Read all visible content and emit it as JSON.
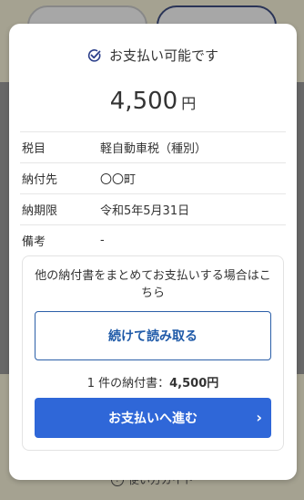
{
  "background": {
    "guide_label": "使い方ガイド"
  },
  "modal": {
    "status_text": "お支払い可能です",
    "amount": "4,500",
    "amount_unit": "円",
    "rows": [
      {
        "label": "税目",
        "value": "軽自動車税（種別）"
      },
      {
        "label": "納付先",
        "value": "〇〇町"
      },
      {
        "label": "納期限",
        "value": "令和5年5月31日"
      },
      {
        "label": "備考",
        "value": "-"
      }
    ],
    "panel": {
      "note": "他の納付書をまとめてお支払いする場合はこちら",
      "scan_button": "続けて読み取る",
      "count_prefix": "1 件の納付書：",
      "count_amount": "4,500円",
      "pay_button": "お支払いへ進む",
      "pay_chevron": "›"
    }
  },
  "colors": {
    "primary": "#2f67d8",
    "outline": "#2b5fa8",
    "background_yellow": "#fbf6d7"
  }
}
